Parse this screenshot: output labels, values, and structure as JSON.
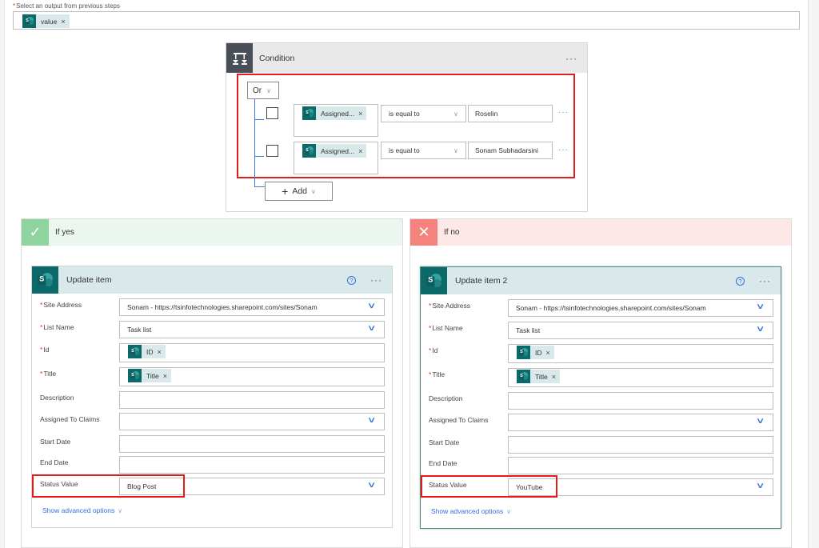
{
  "top": {
    "label": "Select an output from previous steps",
    "token": "value"
  },
  "condition": {
    "title": "Condition",
    "more": "···",
    "group_operator": "Or",
    "rows": [
      {
        "left_token": "Assigned...",
        "operator": "is equal to",
        "value": "Roselin"
      },
      {
        "left_token": "Assigned...",
        "operator": "is equal to",
        "value": "Sonam Subhadarsini"
      }
    ],
    "add_label": "Add"
  },
  "branches": {
    "yes": {
      "label": "If yes",
      "action": {
        "title": "Update item",
        "fields": {
          "site_address": {
            "label": "Site Address",
            "value": "Sonam - https://tsinfotechnologies.sharepoint.com/sites/Sonam"
          },
          "list_name": {
            "label": "List Name",
            "value": "Task list"
          },
          "id": {
            "label": "Id",
            "token": "ID"
          },
          "title": {
            "label": "Title",
            "token": "Title"
          },
          "description": {
            "label": "Description",
            "value": ""
          },
          "assigned_to_claims": {
            "label": "Assigned To Claims",
            "value": ""
          },
          "start_date": {
            "label": "Start Date",
            "value": ""
          },
          "end_date": {
            "label": "End Date",
            "value": ""
          },
          "status_value": {
            "label": "Status Value",
            "value": "Blog Post"
          }
        },
        "advanced": "Show advanced options"
      }
    },
    "no": {
      "label": "If no",
      "action": {
        "title": "Update item 2",
        "fields": {
          "site_address": {
            "label": "Site Address",
            "value": "Sonam - https://tsinfotechnologies.sharepoint.com/sites/Sonam"
          },
          "list_name": {
            "label": "List Name",
            "value": "Task list"
          },
          "id": {
            "label": "Id",
            "token": "ID"
          },
          "title": {
            "label": "Title",
            "token": "Title"
          },
          "description": {
            "label": "Description",
            "value": ""
          },
          "assigned_to_claims": {
            "label": "Assigned To Claims",
            "value": ""
          },
          "start_date": {
            "label": "Start Date",
            "value": ""
          },
          "end_date": {
            "label": "End Date",
            "value": ""
          },
          "status_value": {
            "label": "Status Value",
            "value": "YouTube"
          }
        },
        "advanced": "Show advanced options"
      }
    }
  },
  "icons": {
    "required_mark": "*",
    "remove": "×",
    "help": "?",
    "check": "✓",
    "cross": "✕",
    "plus": "+",
    "chevron": "∨"
  },
  "colors": {
    "highlight_red": "#e21b1b",
    "sharepoint_teal": "#0b6a69",
    "link_blue": "#2f6fe0",
    "yes_green": "#8fd49e",
    "no_red": "#f5827d"
  }
}
